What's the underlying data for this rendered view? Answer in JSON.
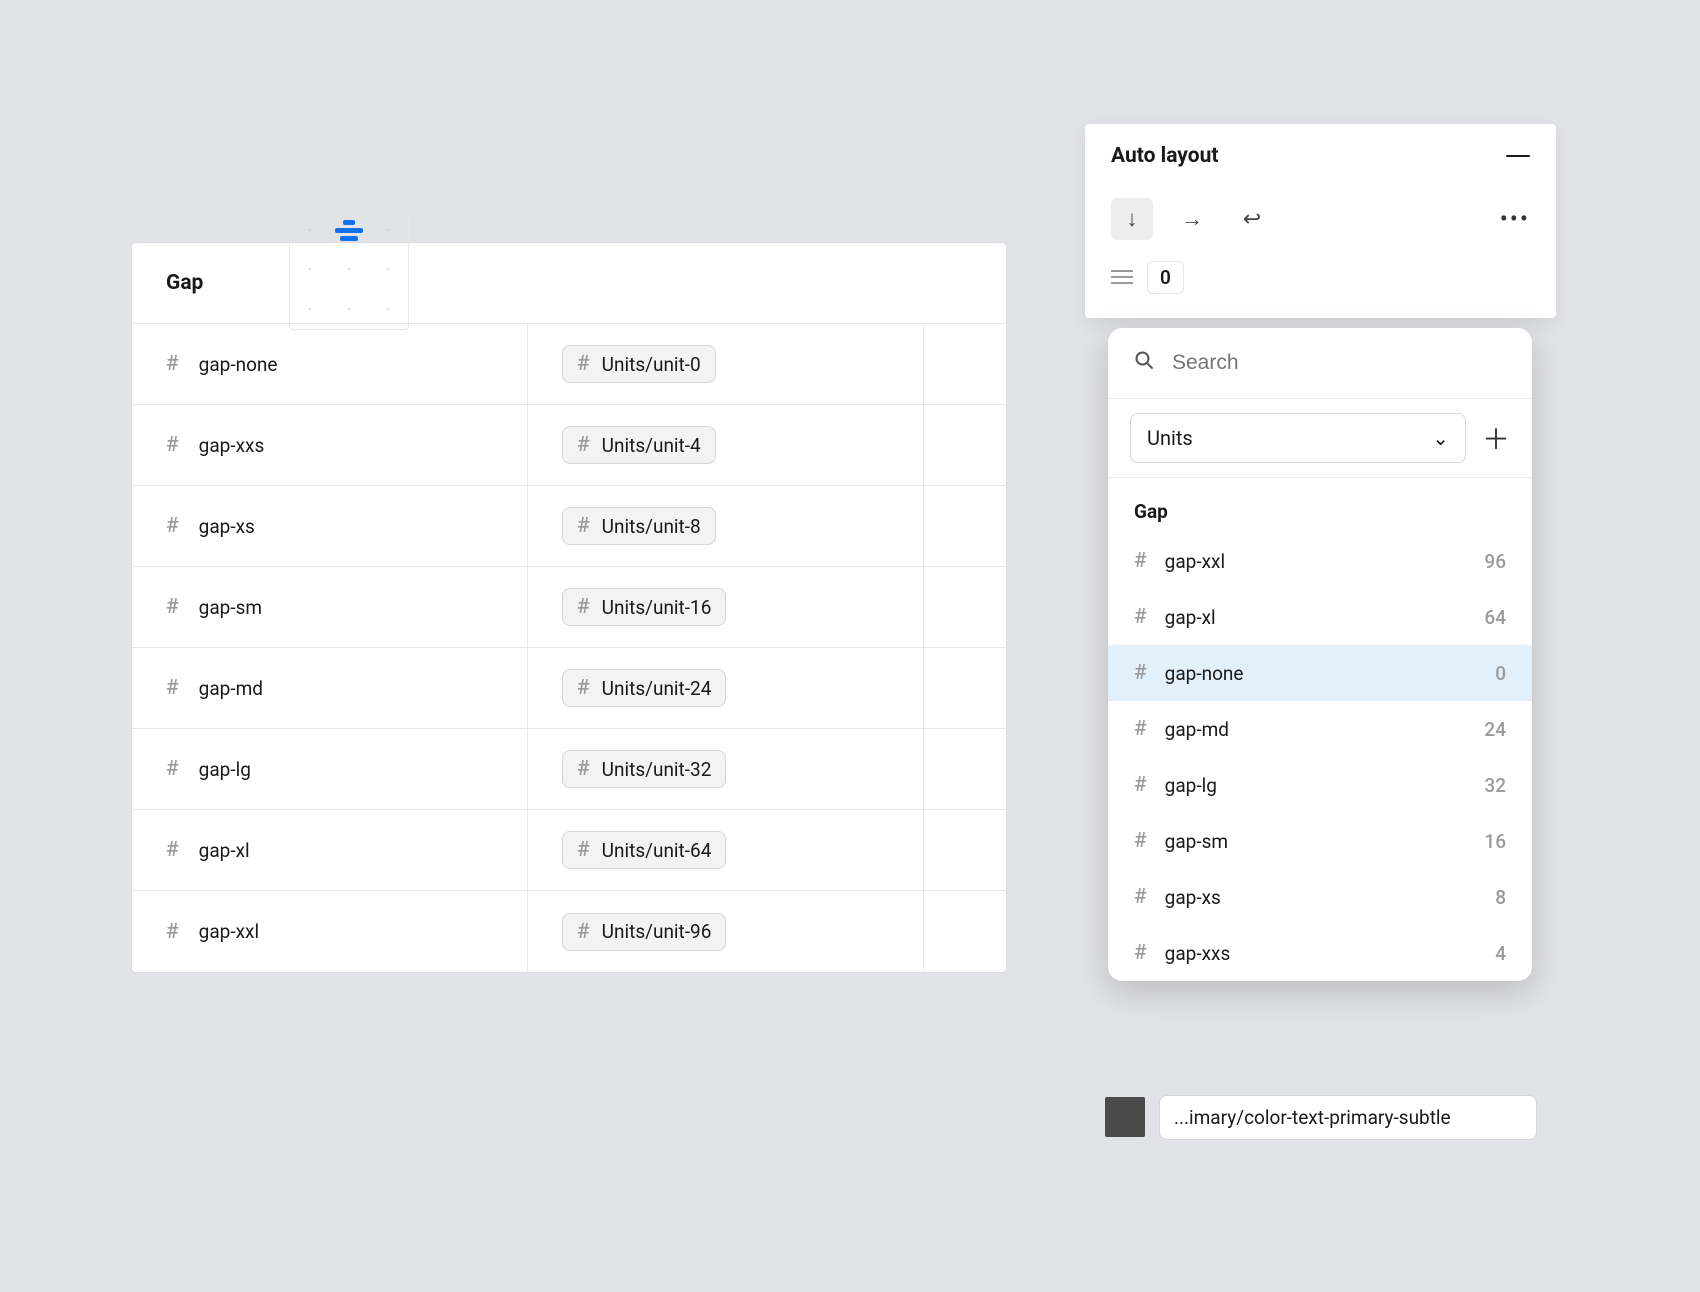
{
  "table": {
    "title": "Gap",
    "rows": [
      {
        "name": "gap-none",
        "unit": "Units/unit-0"
      },
      {
        "name": "gap-xxs",
        "unit": "Units/unit-4"
      },
      {
        "name": "gap-xs",
        "unit": "Units/unit-8"
      },
      {
        "name": "gap-sm",
        "unit": "Units/unit-16"
      },
      {
        "name": "gap-md",
        "unit": "Units/unit-24"
      },
      {
        "name": "gap-lg",
        "unit": "Units/unit-32"
      },
      {
        "name": "gap-xl",
        "unit": "Units/unit-64"
      },
      {
        "name": "gap-xxl",
        "unit": "Units/unit-96"
      }
    ]
  },
  "panel": {
    "title": "Auto layout",
    "gap_value": "0"
  },
  "popover": {
    "search_placeholder": "Search",
    "select_label": "Units",
    "list_heading": "Gap",
    "selected_index": 2,
    "options": [
      {
        "name": "gap-xxl",
        "value": "96"
      },
      {
        "name": "gap-xl",
        "value": "64"
      },
      {
        "name": "gap-none",
        "value": "0"
      },
      {
        "name": "gap-md",
        "value": "24"
      },
      {
        "name": "gap-lg",
        "value": "32"
      },
      {
        "name": "gap-sm",
        "value": "16"
      },
      {
        "name": "gap-xs",
        "value": "8"
      },
      {
        "name": "gap-xxs",
        "value": "4"
      }
    ]
  },
  "swatch": {
    "label": "...imary/color-text-primary-subtle"
  }
}
